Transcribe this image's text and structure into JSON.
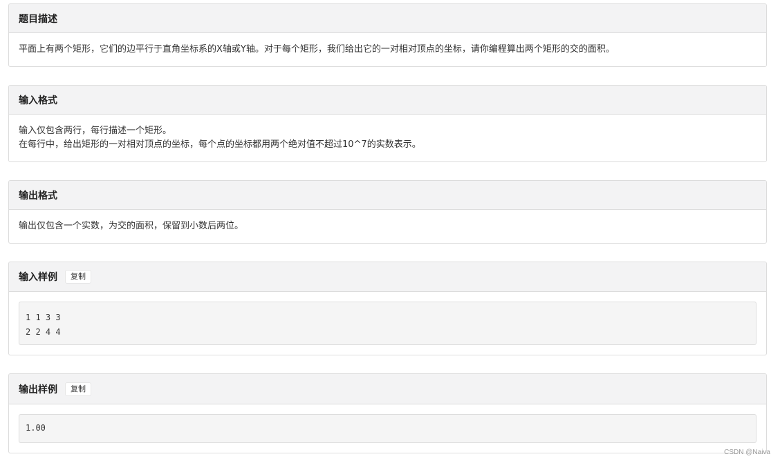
{
  "sections": {
    "description": {
      "title": "题目描述",
      "lines": [
        "平面上有两个矩形，它们的边平行于直角坐标系的X轴或Y轴。对于每个矩形，我们给出它的一对相对顶点的坐标，请你编程算出两个矩形的交的面积。"
      ]
    },
    "input_format": {
      "title": "输入格式",
      "lines": [
        "输入仅包含两行，每行描述一个矩形。",
        "在每行中，给出矩形的一对相对顶点的坐标，每个点的坐标都用两个绝对值不超过10^7的实数表示。"
      ]
    },
    "output_format": {
      "title": "输出格式",
      "lines": [
        "输出仅包含一个实数，为交的面积，保留到小数后两位。"
      ]
    },
    "input_sample": {
      "title": "输入样例",
      "copy_label": "复制",
      "code_lines": [
        "1 1 3 3",
        "2 2 4 4"
      ]
    },
    "output_sample": {
      "title": "输出样例",
      "copy_label": "复制",
      "code_lines": [
        "1.00"
      ]
    }
  },
  "watermark": "CSDN @Naiva"
}
